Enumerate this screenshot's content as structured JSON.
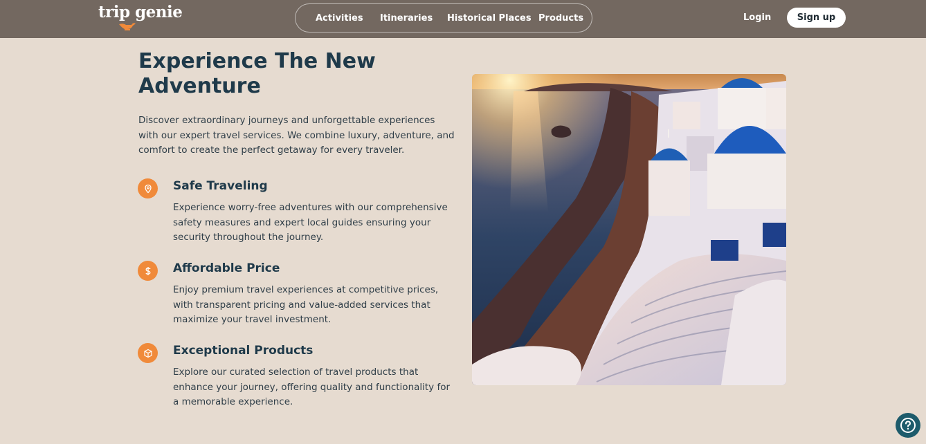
{
  "brand": {
    "logo_text": "trip genie",
    "accent_color": "#f08a3a"
  },
  "nav": {
    "links": [
      {
        "label": "Activities"
      },
      {
        "label": "Itineraries"
      },
      {
        "label": "Historical Places"
      },
      {
        "label": "Products"
      }
    ],
    "login_label": "Login",
    "signup_label": "Sign up"
  },
  "hero": {
    "title": "Experience The New Adventure",
    "description": "Discover extraordinary journeys and unforgettable experiences with our expert travel services. We combine luxury, adventure, and comfort to create the perfect getaway for every traveler.",
    "features": [
      {
        "icon": "map-pin-icon",
        "title": "Safe Traveling",
        "description": "Experience worry-free adventures with our comprehensive safety measures and expert local guides ensuring your security throughout the journey."
      },
      {
        "icon": "dollar-icon",
        "title": "Affordable Price",
        "description": "Enjoy premium travel experiences at competitive prices, with transparent pricing and value-added services that maximize your travel investment."
      },
      {
        "icon": "box-icon",
        "title": "Exceptional Products",
        "description": "Explore our curated selection of travel products that enhance your journey, offering quality and functionality for a memorable experience."
      }
    ],
    "image_subject": "santorini-sunset"
  },
  "help": {
    "icon": "help-icon"
  }
}
